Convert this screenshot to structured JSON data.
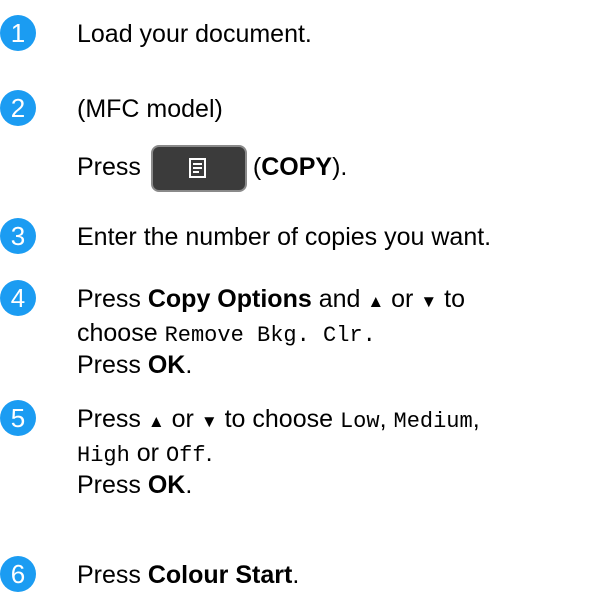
{
  "steps": [
    {
      "number": "1",
      "lines": [
        {
          "text": "Load your document."
        }
      ]
    },
    {
      "number": "2",
      "lines": [
        {
          "text": "(MFC model)"
        },
        {
          "press": "Press",
          "paren_open": "(",
          "copy": "COPY",
          "paren_close": ")."
        }
      ]
    },
    {
      "number": "3",
      "lines": [
        {
          "text": "Enter the number of copies you want."
        }
      ]
    },
    {
      "number": "4",
      "lines": [
        {
          "press": "Press",
          "bold": "Copy Options",
          "mid": "and",
          "up": "▲",
          "or": "or",
          "down": "▼",
          "to": "to"
        },
        {
          "choose": "choose",
          "mono": "Remove Bkg. Clr."
        },
        {
          "press": "Press",
          "bold": "OK",
          "end": "."
        }
      ]
    },
    {
      "number": "5",
      "lines": [
        {
          "press": "Press",
          "up": "▲",
          "or": "or",
          "down": "▼",
          "tochoose": "to choose",
          "m1": "Low",
          "m2": "Medium"
        },
        {
          "m3": "High",
          "or": "or",
          "m4": "Off",
          "end": "."
        },
        {
          "press": "Press",
          "bold": "OK",
          "end": "."
        }
      ]
    },
    {
      "number": "6",
      "lines": [
        {
          "press": "Press",
          "bold": "Colour Start",
          "end": "."
        }
      ]
    }
  ]
}
